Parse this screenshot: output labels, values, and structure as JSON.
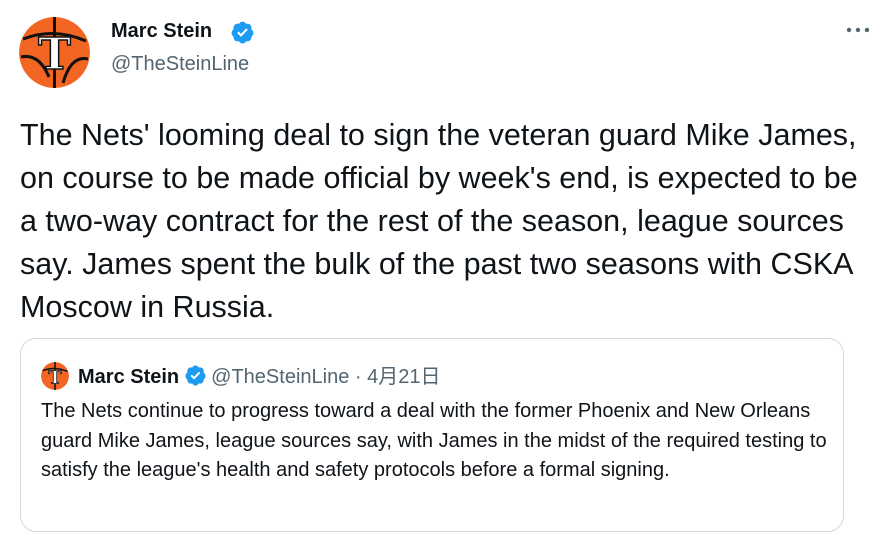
{
  "author": {
    "display_name": "Marc Stein",
    "handle": "@TheSteinLine"
  },
  "icons": {
    "avatar": "avatar-logo",
    "verified": "verified-badge-icon",
    "more": "more-options-icon"
  },
  "tweet": {
    "text": "The Nets' looming deal to sign the veteran guard Mike James, on course to be made official by week's end, is expected to be a two-way contract for the rest of the season, league sources say. James spent the bulk of the past two seasons with CSKA Moscow in Russia."
  },
  "quoted_tweet": {
    "display_name": "Marc Stein",
    "handle": "@TheSteinLine",
    "separator": " · ",
    "date": "4月21日",
    "text": "The Nets continue to progress toward a deal with the former Phoenix and New Orleans guard Mike James, league sources say, with James in the midst of the required testing to satisfy the league's health and safety protocols before a formal signing."
  },
  "colors": {
    "text": "#0f1419",
    "secondary": "#536471",
    "verified": "#1d9bf0",
    "border": "#cfd9de",
    "avatar_orange": "#f26522"
  }
}
